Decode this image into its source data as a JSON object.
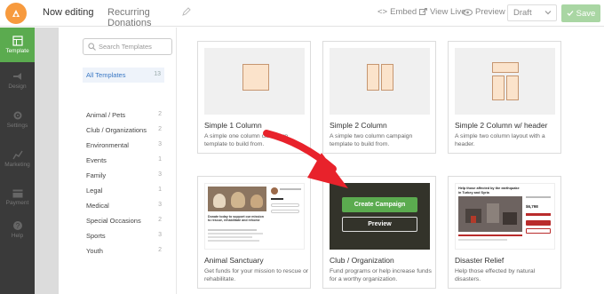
{
  "topbar": {
    "now_editing": "Now editing",
    "campaign_name": "Recurring Donations",
    "embed": "Embed",
    "view_live": "View Live",
    "preview": "Preview",
    "status": "Draft",
    "save": "Save"
  },
  "sidebar": {
    "items": [
      {
        "label": "Template",
        "icon": "template-icon"
      },
      {
        "label": "Design",
        "icon": "megaphone-icon"
      },
      {
        "label": "Settings",
        "icon": "gear-icon"
      },
      {
        "label": "Marketing",
        "icon": "chart-icon"
      },
      {
        "label": "Payment",
        "icon": "card-icon"
      },
      {
        "label": "Help",
        "icon": "help-icon"
      }
    ]
  },
  "filters": {
    "search_placeholder": "Search Templates",
    "all": {
      "label": "All Templates",
      "count": "13"
    },
    "categories": [
      {
        "label": "Animal / Pets",
        "count": "2"
      },
      {
        "label": "Club / Organizations",
        "count": "2"
      },
      {
        "label": "Environmental",
        "count": "3"
      },
      {
        "label": "Events",
        "count": "1"
      },
      {
        "label": "Family",
        "count": "3"
      },
      {
        "label": "Legal",
        "count": "1"
      },
      {
        "label": "Medical",
        "count": "3"
      },
      {
        "label": "Special Occasions",
        "count": "2"
      },
      {
        "label": "Sports",
        "count": "3"
      },
      {
        "label": "Youth",
        "count": "2"
      }
    ]
  },
  "templates": [
    {
      "title": "Simple 1 Column",
      "desc": "A simple one column campaign template to build from."
    },
    {
      "title": "Simple 2 Column",
      "desc": "A simple two column campaign template to build from."
    },
    {
      "title": "Simple 2 Column w/ header",
      "desc": "A simple two column layout with a header."
    },
    {
      "title": "Animal Sanctuary",
      "desc": "Get funds for your mission to rescue or rehabilitate."
    },
    {
      "title": "Club / Organization",
      "desc": "Fund programs or help increase funds for a worthy organization."
    },
    {
      "title": "Disaster Relief",
      "desc": "Help those effected by natural disasters."
    }
  ],
  "hover_actions": {
    "create": "Create Campaign",
    "preview": "Preview"
  },
  "thumb_text": {
    "animal_headline": "Donate today to support our mission to rescue, rehabilitate and rehome",
    "disaster_headline": "Help those affected by the earthquake in Turkey and Syria",
    "disaster_amount": "$6,798"
  },
  "colors": {
    "accent": "#5bab4f",
    "arrow": "#e8222b",
    "logo": "#f79a3e"
  }
}
